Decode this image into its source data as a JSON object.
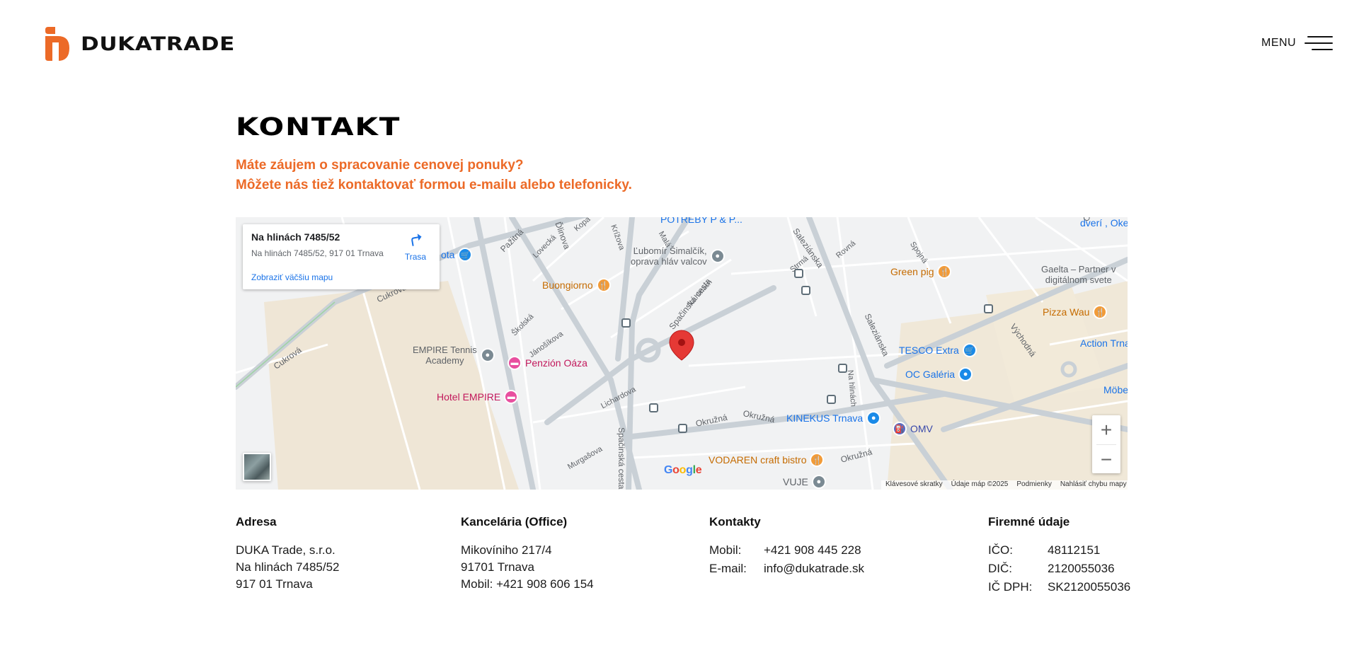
{
  "header": {
    "brand": "DUKATRADE",
    "menu_label": "MENU",
    "accent": "#ec6a27"
  },
  "page": {
    "title": "KONTAKT",
    "subtitle_line1": "Máte záujem o spracovanie cenovej ponuky?",
    "subtitle_line2": "Môžete nás tiež kontaktovať formou e-mailu alebo telefonicky."
  },
  "map": {
    "info_title": "Na hlinách 7485/52",
    "info_address": "Na hlinách 7485/52, 917 01 Trnava",
    "directions_label": "Trasa",
    "larger_map_link": "Zobraziť väčšiu mapu",
    "zoom_in": "+",
    "zoom_out": "−",
    "google_logo": "Google",
    "attribution": [
      "Klávesové skratky",
      "Údaje máp ©2025",
      "Podmienky",
      "Nahlásiť chybu mapy"
    ],
    "pois": {
      "sima_name": "Ľubomír Šimalčík,",
      "sima_sub": "oprava hláv valcov",
      "green_pig": "Green pig",
      "buongiorno": "Buongiorno",
      "gaelta_line1": "Gaelta – Partner v",
      "gaelta_line2": "digitálnom svete",
      "pizza_wau": "Pizza Wau",
      "action": "Action Trna",
      "empire_tennis_1": "EMPIRE Tennis",
      "empire_tennis_2": "Academy",
      "penzion": "Penzión Oáza",
      "hotel_empire": "Hotel EMPIRE",
      "tesco": "TESCO Extra",
      "oc_galeria": "OC Galéria",
      "kinekus": "KINEKUS Trnava",
      "omv": "OMV",
      "vodaren": "VODAREN craft bistro",
      "vuje": "VUJE",
      "potreby": "POTREBY P & P...",
      "dveri": "dverí , Oke",
      "mobe": "Möbe",
      "ota": "ota"
    },
    "streets": {
      "pazitna": "Pažitná",
      "lovecka": "Lovecká",
      "kopa": "Kopa",
      "krizova": "Krížova",
      "mala": "Malá",
      "skolska": "Školská",
      "janosikova": "Jánošíkova",
      "spacinska1": "Spačinská cesta",
      "spacinska2": "Spačinská cesta",
      "na_hlinach1": "Na hlinách",
      "na_hlinach2": "Na hlinách",
      "strma": "Strmá",
      "rovna": "Rovná",
      "spojna": "Spojná",
      "salezianska1": "Saleziánska",
      "salezianska2": "Saleziánska",
      "cukrova1": "Cukrová",
      "cukrova2": "Cukrová",
      "lichardova": "Lichardova",
      "okruzna1": "Okružná",
      "okruzna2": "Okružná",
      "okruzna3": "Okružná",
      "murgasova": "Murgašova",
      "vychodna": "Východná",
      "olympijska": "Olympijská",
      "dlinova": "Ďlinova"
    }
  },
  "footer": {
    "address": {
      "heading": "Adresa",
      "lines": [
        "DUKA Trade, s.r.o.",
        "Na hlinách 7485/52",
        "917 01 Trnava"
      ]
    },
    "office": {
      "heading": "Kancelária (Office)",
      "lines": [
        "Mikovíniho 217/4",
        "91701 Trnava",
        "Mobil: +421 908 606 154"
      ]
    },
    "contacts": {
      "heading": "Kontakty",
      "rows": [
        {
          "k": "Mobil:",
          "v": "+421 908 445 228"
        },
        {
          "k": "E-mail:",
          "v": "info@dukatrade.sk"
        }
      ]
    },
    "company": {
      "heading": "Firemné údaje",
      "rows": [
        {
          "k": "IČO:",
          "v": "48112151"
        },
        {
          "k": "DIČ:",
          "v": "2120055036"
        },
        {
          "k": "IČ DPH:",
          "v": "SK2120055036"
        }
      ]
    }
  }
}
